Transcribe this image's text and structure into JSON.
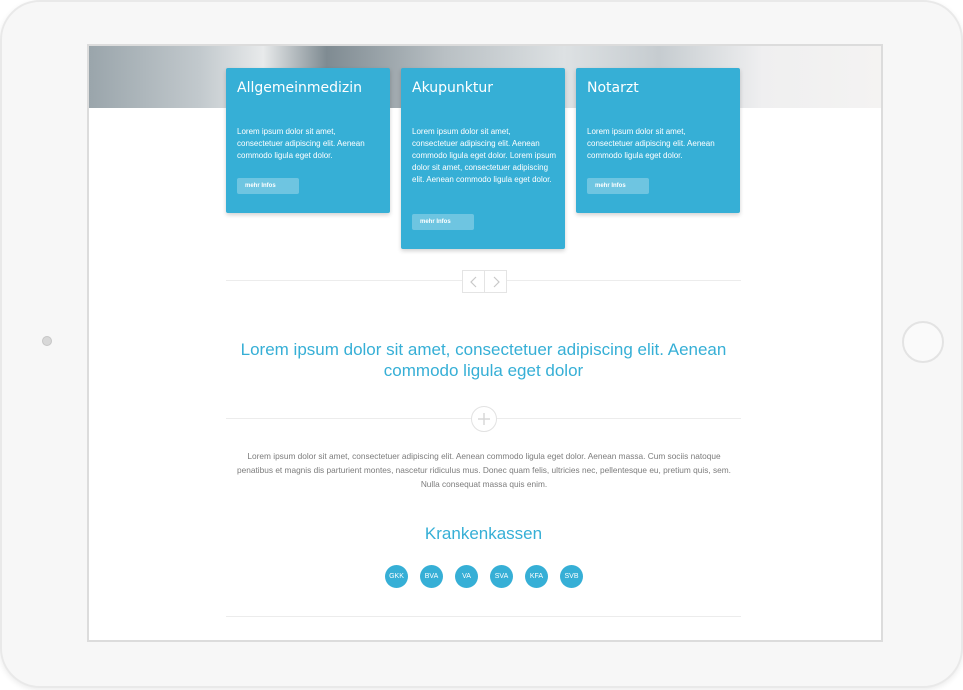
{
  "cards": [
    {
      "title": "Allgemeinmedizin",
      "body": "Lorem ipsum dolor sit amet, consectetuer adipiscing elit. Aenean commodo ligula eget dolor.",
      "button": "mehr Infos"
    },
    {
      "title": "Akupunktur",
      "body": "Lorem ipsum dolor sit amet, consectetuer adipiscing elit. Aenean commodo ligula eget dolor. Lorem ipsum dolor sit amet, consectetuer adipiscing elit. Aenean commodo ligula eget dolor.",
      "button": "mehr Infos"
    },
    {
      "title": "Notarzt",
      "body": "Lorem ipsum dolor sit amet, consectetuer adipiscing elit. Aenean commodo ligula eget dolor.",
      "button": "mehr Infos"
    }
  ],
  "slider": {
    "prev_icon": "chevron-left-icon",
    "next_icon": "chevron-right-icon"
  },
  "headline": "Lorem ipsum dolor sit amet, consectetuer adipiscing elit. Aenean commodo ligula eget dolor",
  "divider_icon": "plus-icon",
  "paragraph": "Lorem ipsum dolor sit amet, consectetuer adipiscing elit. Aenean commodo ligula eget dolor. Aenean massa. Cum sociis natoque penatibus et magnis dis parturient montes, nascetur ridiculus mus. Donec quam felis, ultricies nec, pellentesque eu, pretium quis, sem. Nulla consequat massa quis enim.",
  "krankenkassen": {
    "title": "Krankenkassen",
    "badges": [
      "GKK",
      "BVA",
      "VA",
      "SVA",
      "KFA",
      "SVB"
    ]
  },
  "colors": {
    "accent": "#36afd6",
    "text_muted": "#7c7c7c",
    "divider": "#ececec"
  }
}
